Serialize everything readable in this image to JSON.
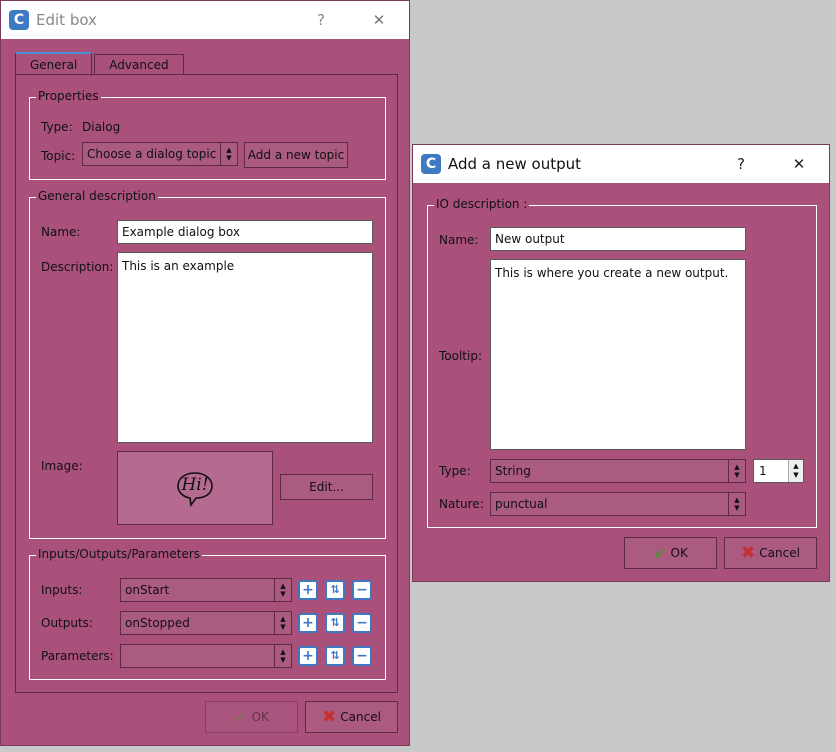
{
  "edit_box": {
    "title": "Edit box",
    "help": "?",
    "close": "✕",
    "tabs": [
      "General",
      "Advanced"
    ],
    "properties": {
      "heading": "Properties",
      "type_label": "Type:",
      "type_value": "Dialog",
      "topic_label": "Topic:",
      "topic_value": "Choose a dialog topic",
      "add_topic": "Add a new topic"
    },
    "general_description": {
      "heading": "General description",
      "name_label": "Name:",
      "name_value": "Example dialog box",
      "description_label": "Description:",
      "description_value": "This is an example",
      "image_label": "Image:",
      "image_text": "Hi!",
      "edit_button": "Edit..."
    },
    "io": {
      "heading": "Inputs/Outputs/Parameters",
      "inputs_label": "Inputs:",
      "inputs_value": "onStart",
      "outputs_label": "Outputs:",
      "outputs_value": "onStopped",
      "parameters_label": "Parameters:",
      "parameters_value": ""
    },
    "ok": "OK",
    "cancel": "Cancel"
  },
  "add_output": {
    "title": "Add a new output",
    "help": "?",
    "close": "✕",
    "heading": "IO description :",
    "name_label": "Name:",
    "name_value": "New output",
    "tooltip_label": "Tooltip:",
    "tooltip_value": "This is where you create a new output.",
    "type_label": "Type:",
    "type_value": "String",
    "count_value": "1",
    "nature_label": "Nature:",
    "nature_value": "punctual",
    "ok": "OK",
    "cancel": "Cancel"
  }
}
